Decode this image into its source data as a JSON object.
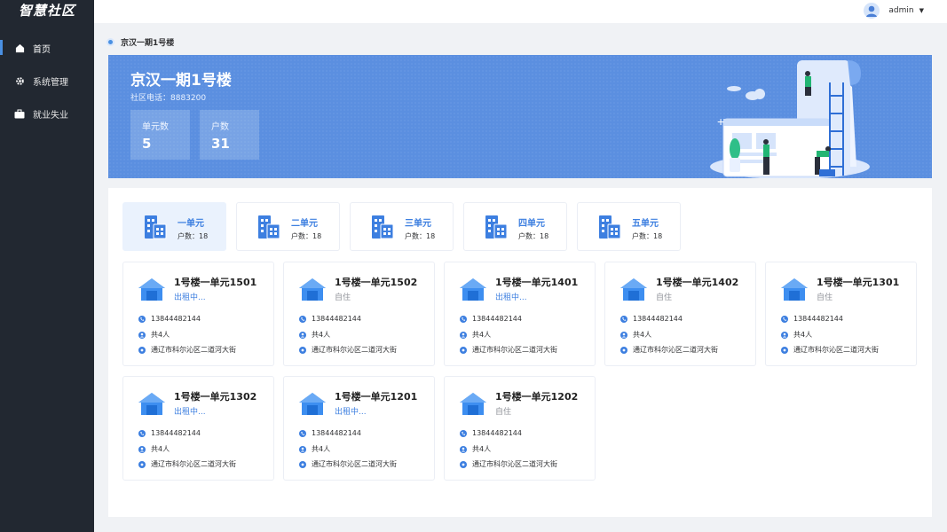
{
  "app": {
    "logo": "智慧社区"
  },
  "sidebar": {
    "items": [
      {
        "label": "首页",
        "icon": "home-icon",
        "active": true
      },
      {
        "label": "系统管理",
        "icon": "gear-icon",
        "active": false
      },
      {
        "label": "就业失业",
        "icon": "briefcase-icon",
        "active": false
      }
    ]
  },
  "header": {
    "username": "admin"
  },
  "breadcrumb": {
    "title": "京汉一期1号楼"
  },
  "banner": {
    "title": "京汉一期1号楼",
    "phone": "社区电话：8883200",
    "stats": [
      {
        "label": "单元数",
        "value": "5"
      },
      {
        "label": "户数",
        "value": "31"
      }
    ]
  },
  "units": [
    {
      "name": "一单元",
      "count": "户数：18",
      "active": true
    },
    {
      "name": "二单元",
      "count": "户数：18",
      "active": false
    },
    {
      "name": "三单元",
      "count": "户数：18",
      "active": false
    },
    {
      "name": "四单元",
      "count": "户数：18",
      "active": false
    },
    {
      "name": "五单元",
      "count": "户数：18",
      "active": false
    }
  ],
  "rooms": [
    {
      "name": "1号楼一单元1501",
      "status": "出租中...",
      "status_type": "rent",
      "phone": "13844482144",
      "people": "共4人",
      "address": "通辽市科尔沁区二道河大街"
    },
    {
      "name": "1号楼一单元1502",
      "status": "自住",
      "status_type": "self",
      "phone": "13844482144",
      "people": "共4人",
      "address": "通辽市科尔沁区二道河大街"
    },
    {
      "name": "1号楼一单元1401",
      "status": "出租中...",
      "status_type": "rent",
      "phone": "13844482144",
      "people": "共4人",
      "address": "通辽市科尔沁区二道河大街"
    },
    {
      "name": "1号楼一单元1402",
      "status": "自住",
      "status_type": "self",
      "phone": "13844482144",
      "people": "共4人",
      "address": "通辽市科尔沁区二道河大街"
    },
    {
      "name": "1号楼一单元1301",
      "status": "自住",
      "status_type": "self",
      "phone": "13844482144",
      "people": "共4人",
      "address": "通辽市科尔沁区二道河大街"
    },
    {
      "name": "1号楼一单元1302",
      "status": "出租中...",
      "status_type": "rent",
      "phone": "13844482144",
      "people": "共4人",
      "address": "通辽市科尔沁区二道河大街"
    },
    {
      "name": "1号楼一单元1201",
      "status": "出租中...",
      "status_type": "rent",
      "phone": "13844482144",
      "people": "共4人",
      "address": "通辽市科尔沁区二道河大街"
    },
    {
      "name": "1号楼一单元1202",
      "status": "自住",
      "status_type": "self",
      "phone": "13844482144",
      "people": "共4人",
      "address": "通辽市科尔沁区二道河大街"
    }
  ],
  "colors": {
    "accent": "#3d7fe0",
    "sidebar": "#222831",
    "banner": "#5b8fe0"
  }
}
